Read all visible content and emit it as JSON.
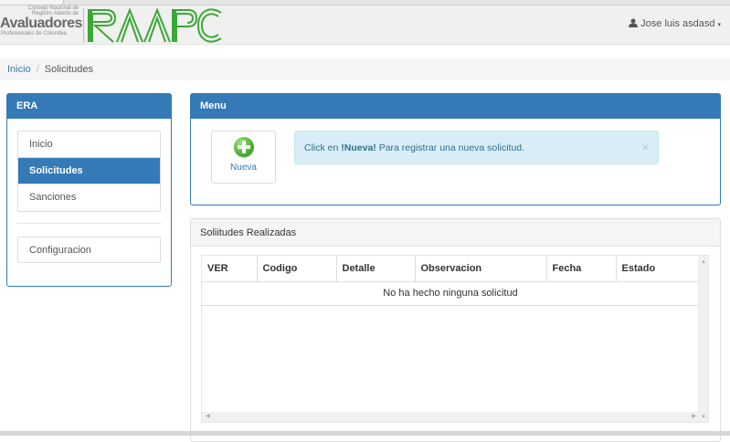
{
  "header": {
    "logo_line1": "Consejo Nacional de",
    "logo_line2": "Registro Abierto de",
    "logo_big": "Avaluadores",
    "logo_sub": "Profesionales de Colombia",
    "logo_graphic_text": "RAAPC",
    "user_name": "Jose luis asdasd",
    "user_icon": "user-icon",
    "caret": "▾"
  },
  "breadcrumb": {
    "home": "Inicio",
    "separator": "/",
    "current": "Solicitudes"
  },
  "sidebar": {
    "title": "ERA",
    "items": [
      {
        "label": "Inicio"
      },
      {
        "label": "Solicitudes"
      },
      {
        "label": "Sanciones"
      }
    ],
    "config_label": "Configuracion"
  },
  "menu": {
    "title": "Menu",
    "new_button_label": "Nueva",
    "alert_prefix": "Click en ",
    "alert_bold": "!Nueva!",
    "alert_suffix": " Para registrar una nueva solicitud.",
    "alert_close": "×"
  },
  "solicitudes": {
    "title": "Soliitudes Realizadas",
    "columns": [
      "VER",
      "Codigo",
      "Detalle",
      "Observacion",
      "Fecha",
      "Estado"
    ],
    "empty_message": "No ha hecho ninguna solicitud"
  },
  "colors": {
    "primary": "#337ab7",
    "alert_bg": "#d9edf7",
    "alert_text": "#31708f",
    "logo_green": "#3aa935"
  }
}
